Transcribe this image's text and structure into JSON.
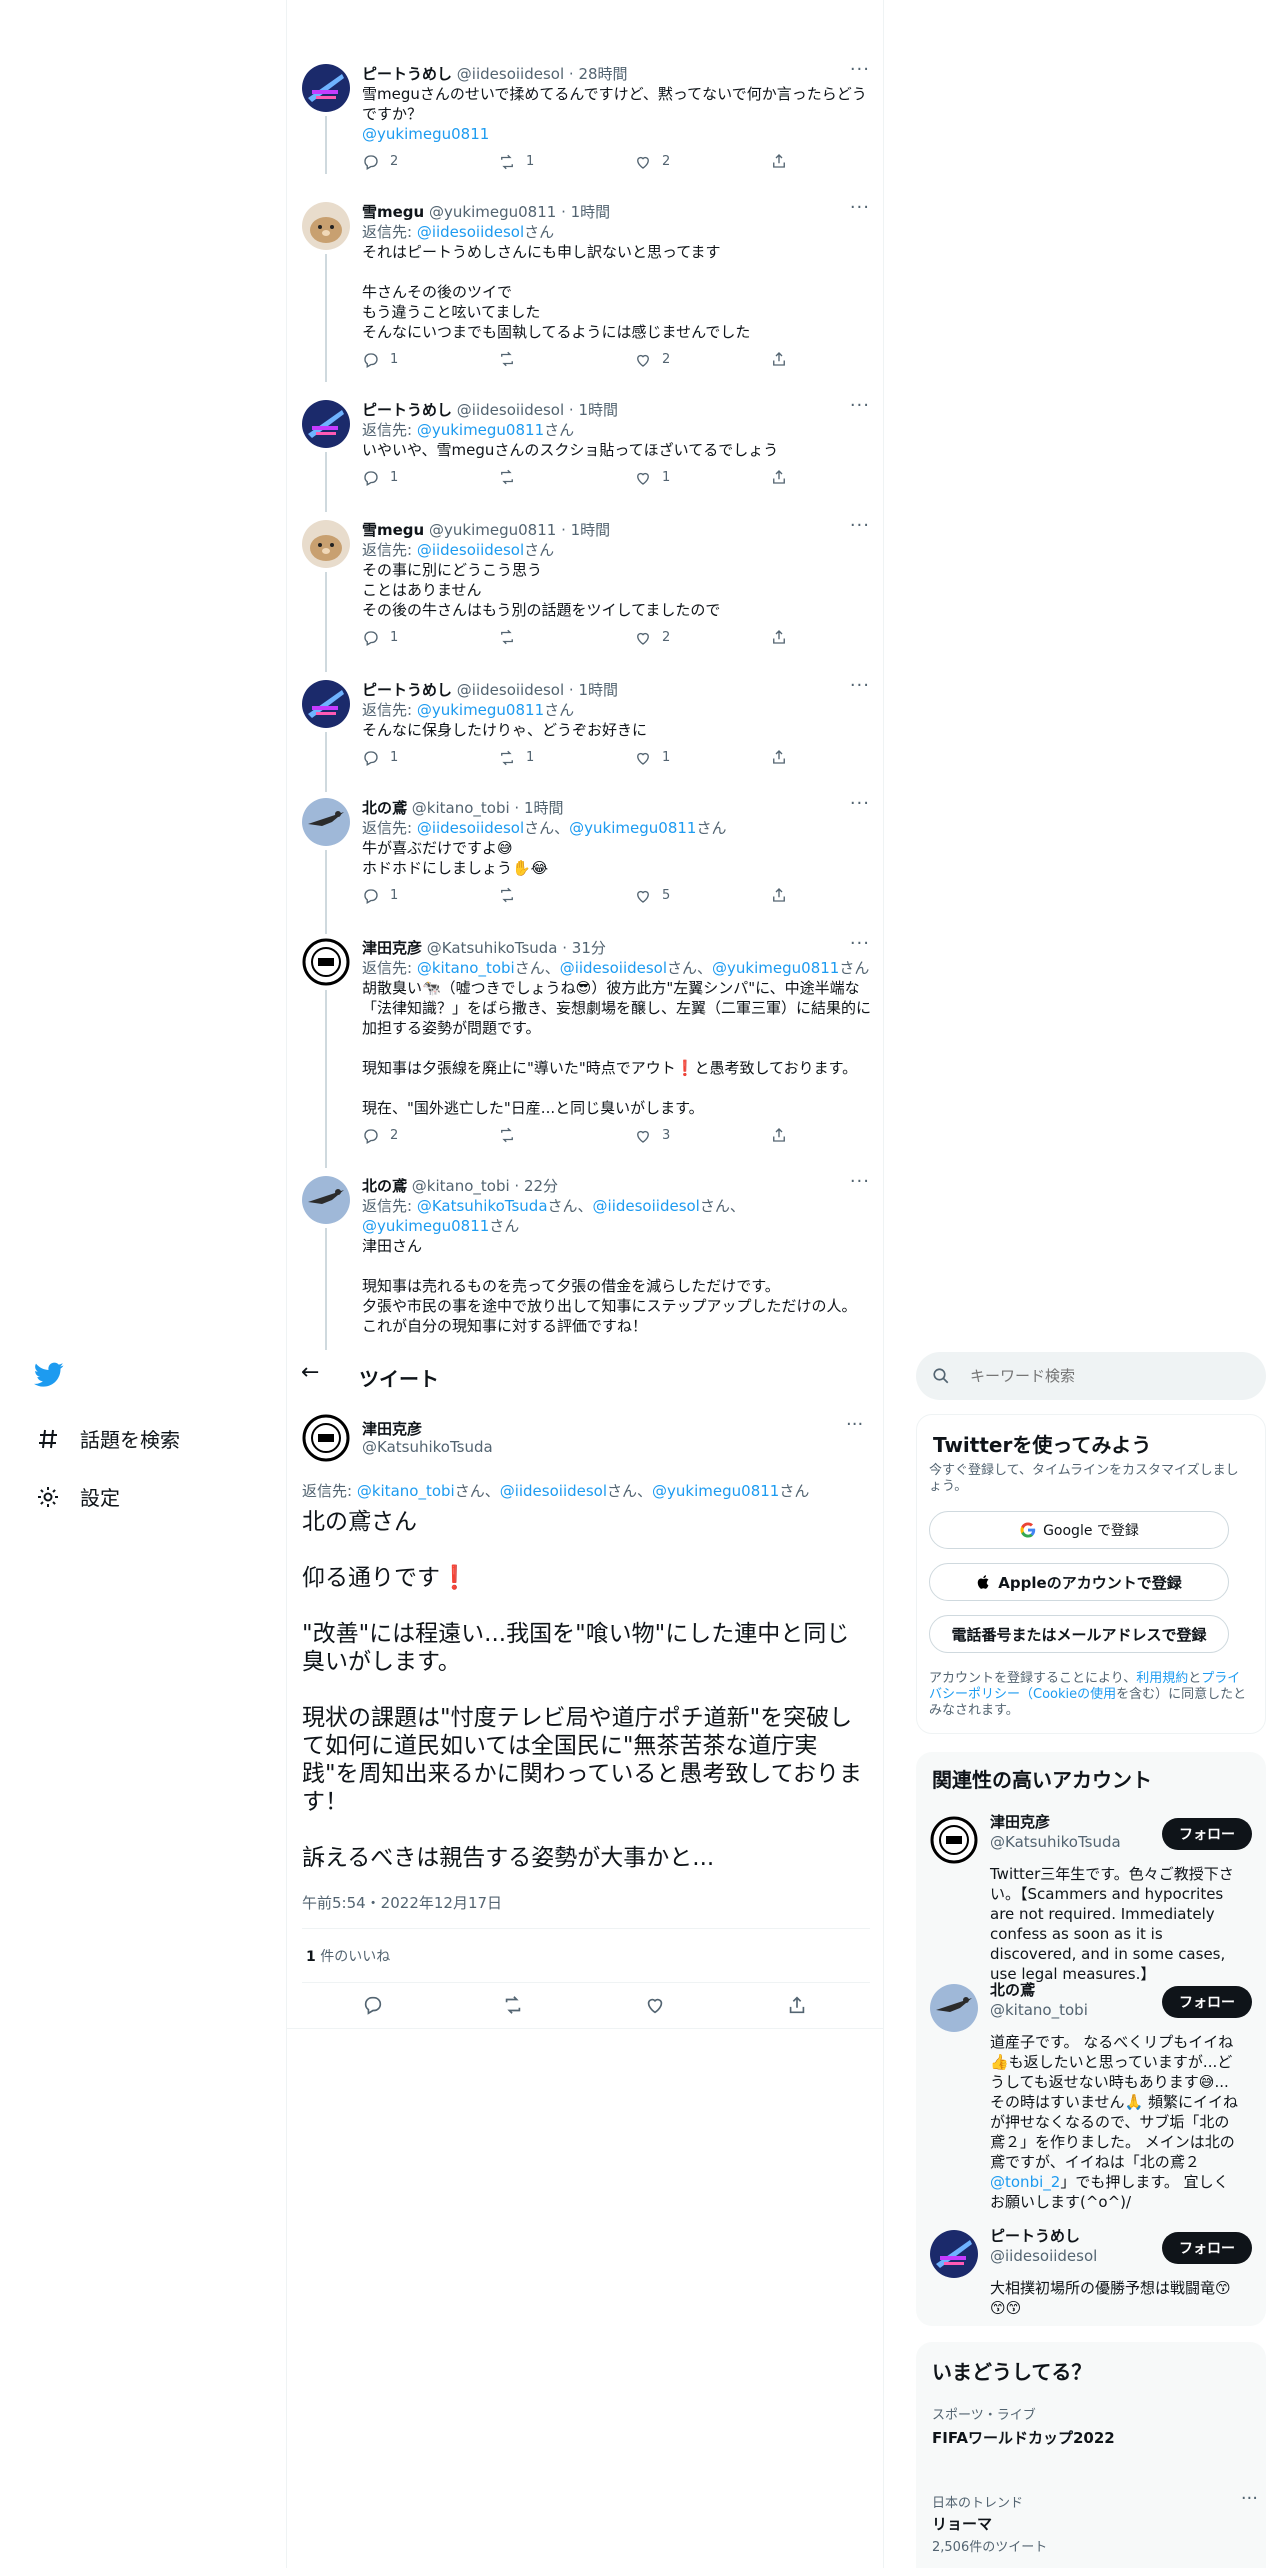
{
  "replies": [
    {
      "name": "ピートうめし",
      "handle": "@iidesoiidesol",
      "time": "28時間",
      "reply_to": "",
      "text": "雪meguさんのせいで揉めてるんですけど、黙ってないで何か言ったらどうですか？",
      "mention_line": "@yukimegu0811",
      "counts": {
        "reply": "2",
        "retweet": "1",
        "like": "2"
      }
    },
    {
      "name": "雪megu",
      "handle": "@yukimegu0811",
      "time": "1時間",
      "reply_to_prefix": "返信先: ",
      "reply_to_mention": "@iidesoiidesol",
      "reply_to_suffix": "さん",
      "text": "それはピートうめしさんにも申し訳ないと思ってます\n\n牛さんその後のツイで\nもう違うこと呟いてました\nそんなにいつまでも固執してるようには感じませんでした",
      "counts": {
        "reply": "1",
        "retweet": "",
        "like": "2"
      }
    },
    {
      "name": "ピートうめし",
      "handle": "@iidesoiidesol",
      "time": "1時間",
      "reply_to_prefix": "返信先: ",
      "reply_to_mention": "@yukimegu0811",
      "reply_to_suffix": "さん",
      "text": "いやいや、雪meguさんのスクショ貼ってほざいてるでしょう",
      "counts": {
        "reply": "1",
        "retweet": "",
        "like": "1"
      }
    },
    {
      "name": "雪megu",
      "handle": "@yukimegu0811",
      "time": "1時間",
      "reply_to_prefix": "返信先: ",
      "reply_to_mention": "@iidesoiidesol",
      "reply_to_suffix": "さん",
      "text": "その事に別にどうこう思う\nことはありません\nその後の牛さんはもう別の話題をツイしてましたので",
      "counts": {
        "reply": "1",
        "retweet": "",
        "like": "2"
      }
    },
    {
      "name": "ピートうめし",
      "handle": "@iidesoiidesol",
      "time": "1時間",
      "reply_to_prefix": "返信先: ",
      "reply_to_mention": "@yukimegu0811",
      "reply_to_suffix": "さん",
      "text": "そんなに保身したけりゃ、どうぞお好きに",
      "counts": {
        "reply": "1",
        "retweet": "1",
        "like": "1"
      }
    },
    {
      "name": "北の鳶",
      "handle": "@kitano_tobi",
      "time": "1時間",
      "reply_to_prefix": "返信先: ",
      "reply_to_mention": "@iidesoiidesol",
      "reply_to_mid": "さん、",
      "reply_to_mention2": "@yukimegu0811",
      "reply_to_suffix": "さん",
      "text": "牛が喜ぶだけですよ😅\nホドホドにしましょう✋😂",
      "counts": {
        "reply": "1",
        "retweet": "",
        "like": "5"
      }
    },
    {
      "name": "津田克彦",
      "handle": "@KatsuhikoTsuda",
      "time": "31分",
      "reply_to_prefix": "返信先: ",
      "reply_to_mention": "@kitano_tobi",
      "reply_to_mid": "さん、",
      "reply_to_mention2": "@iidesoiidesol",
      "reply_to_mid2": "さん、",
      "reply_to_mention3": "@yukimegu0811",
      "reply_to_suffix": "さん",
      "text": "胡散臭い🐄（嘘つきでしょうね😎）彼方此方\"左翼シンパ\"に、中途半端な「法律知識？」をばら撒き、妄想劇場を醸し、左翼（二軍三軍）に結果的に加担する姿勢が問題です。\n\n現知事は夕張線を廃止に\"導いた\"時点でアウト❗と愚考致しております。\n\n現在、\"国外逃亡した\"日産...と同じ臭いがします。",
      "counts": {
        "reply": "2",
        "retweet": "",
        "like": "3"
      }
    },
    {
      "name": "北の鳶",
      "handle": "@kitano_tobi",
      "time": "22分",
      "reply_to_prefix": "返信先: ",
      "reply_to_mention": "@KatsuhikoTsuda",
      "reply_to_mid": "さん、",
      "reply_to_mention2": "@iidesoiidesol",
      "reply_to_mid2": "さん、",
      "reply_to_mention3": "@yukimegu0811",
      "reply_to_suffix": "さん",
      "text": "津田さん\n\n現知事は売れるものを売って夕張の借金を減らしただけです。\n夕張や市民の事を途中で放り出して知事にステップアップしただけの人。\nこれが自分の現知事に対する評価ですね！\n\nこんな人間がトップにいると、道民の事など考える訳がありません😅"
    }
  ],
  "sidebar": {
    "explore_label": "話題を検索",
    "settings_label": "設定"
  },
  "header": {
    "back": "←",
    "title": "ツイート"
  },
  "main_tweet": {
    "name": "津田克彦",
    "handle": "@KatsuhikoTsuda",
    "reply_prefix": "返信先: ",
    "m1": "@kitano_tobi",
    "s1": "さん、",
    "m2": "@iidesoiidesol",
    "s2": "さん、",
    "m3": "@yukimegu0811",
    "s3": "さん",
    "text": "北の鳶さん\n\n仰る通りです❗\n\n\"改善\"には程遠い...我国を\"喰い物\"にした連中と同じ臭いがします。\n\n現状の課題は\"忖度テレビ局や道庁ポチ道新\"を突破して如何に道民如いては全国民に\"無茶苦茶な道庁実践\"を周知出来るかに関わっていると愚考致しております！\n\n訴えるべきは親告する姿勢が大事かと...",
    "timestamp": "午前5:54・2022年12月17日",
    "likes_count": "1",
    "likes_label": " 件のいいね"
  },
  "search": {
    "placeholder": "キーワード検索"
  },
  "signup": {
    "title": "Twitterを使ってみよう",
    "subtitle": "今すぐ登録して、タイムラインをカスタマイズしましょう。",
    "google": "Google で登録",
    "apple": "Appleのアカウントで登録",
    "email": "電話番号またはメールアドレスで登録",
    "legal_prefix": "アカウントを登録することにより、",
    "terms": "利用規約",
    "and": "と",
    "privacy": "プライバシーポリシー（Cookieの使用",
    "legal_suffix": "を含む）に同意したとみなされます。"
  },
  "related": {
    "title": "関連性の高いアカウント",
    "follow_label": "フォロー",
    "accounts": [
      {
        "name": "津田克彦",
        "handle": "@KatsuhikoTsuda",
        "bio": "Twitter三年生です。色々ご教授下さい。【Scammers and hypocrites are not required. Immediately confess as soon as it is discovered, and in some cases, use legal measures.】"
      },
      {
        "name": "北の鳶",
        "handle": "@kitano_tobi",
        "bio_a": "道産子です。 なるべくリプもイイね👍も返したいと思っていますが...どうしても返せない時もあります😅...その時はすいません🙏 頻繁にイイねが押せなくなるので、サブ垢「北の鳶２」を作りました。 メインは北の鳶ですが、イイねは「北の鳶２",
        "bio_mention": "@tonbi_2",
        "bio_b": "」でも押します。 宜しくお願いします(^o^)/"
      },
      {
        "name": "ピートうめし",
        "handle": "@iidesoiidesol",
        "bio": "大相撲初場所の優勝予想は戦闘竜😙😙😙"
      }
    ]
  },
  "trends": {
    "title": "いまどうしてる？",
    "items": [
      {
        "category": "スポーツ・ライブ",
        "name": "FIFAワールドカップ2022",
        "count": ""
      },
      {
        "category": "日本のトレンド",
        "name": "リョーマ",
        "count": "2,506件のツイート"
      }
    ]
  },
  "colors": {
    "accent": "#1d9bf0",
    "text": "#0f1419",
    "secondary": "#536471",
    "border": "#eff3f4"
  }
}
